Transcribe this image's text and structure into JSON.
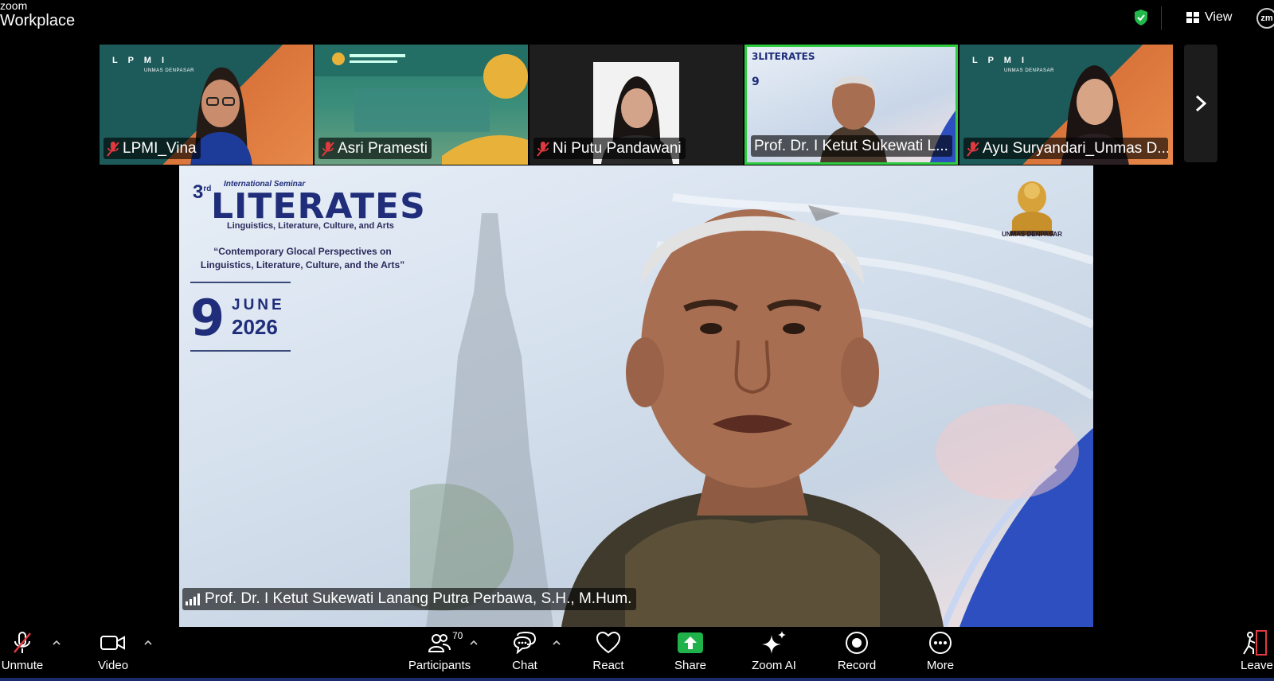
{
  "app": {
    "brand_small": "zoom",
    "brand_big": "Workplace",
    "view_label": "View",
    "avatar_initials": "zm"
  },
  "gallery": {
    "tiles": [
      {
        "name": "LPMI_Vina",
        "muted": true
      },
      {
        "name": "Asri Pramesti",
        "muted": true
      },
      {
        "name": "Ni Putu Pandawani",
        "muted": true
      },
      {
        "name": "Prof. Dr. I Ketut Sukewati L...",
        "muted": false,
        "active": true
      },
      {
        "name": "Ayu Suryandari_Unmas D...",
        "muted": true
      }
    ],
    "lpmi_logo": "L P M I",
    "lpmi_sub": "UNMAS DENPASAR"
  },
  "main_video": {
    "speaker_name": "Prof. Dr. I Ketut Sukewati Lanang Putra Perbawa, S.H., M.Hum.",
    "slide": {
      "number": "3",
      "number_suffix": "rd",
      "intl": "International Seminar",
      "title": "LITERATES",
      "tagline": "Linguistics, Literature, Culture, and Arts",
      "quote": "“Contemporary Glocal Perspectives on Linguistics, Literature, Culture, and the Arts”",
      "day": "9",
      "month": "JUNE",
      "year": "2026",
      "logo_label": "UNMAS DENPASAR"
    }
  },
  "toolbar": {
    "unmute": "Unmute",
    "video": "Video",
    "participants": "Participants",
    "participants_count": "70",
    "chat": "Chat",
    "react": "React",
    "share": "Share",
    "zoom_ai": "Zoom AI",
    "record": "Record",
    "more": "More",
    "leave": "Leave"
  },
  "colors": {
    "active_border": "#2ecc40",
    "share_green": "#1fb24a",
    "mute_red": "#e0393e",
    "shield_green": "#22b84c",
    "slide_navy": "#1f2d7a"
  }
}
